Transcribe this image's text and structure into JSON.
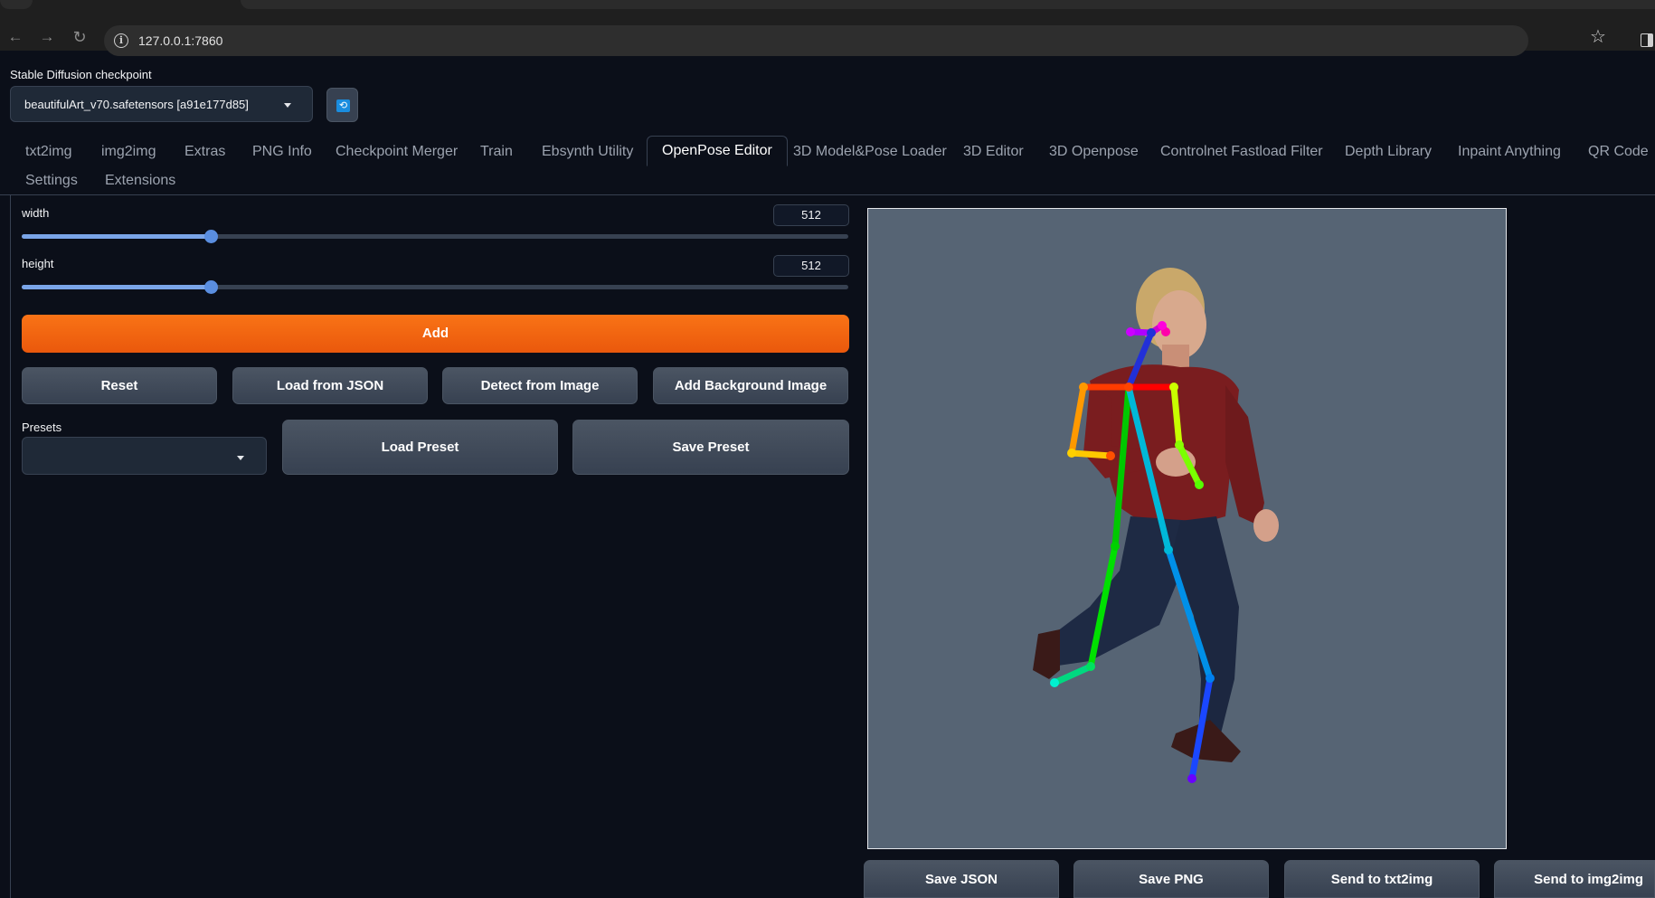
{
  "browser": {
    "url": "127.0.0.1:7860"
  },
  "checkpoint": {
    "label": "Stable Diffusion checkpoint",
    "value": "beautifulArt_v70.safetensors [a91e177d85]",
    "refresh_icon": "refresh-icon",
    "refresh_color": "#1a8ddf"
  },
  "tabs": {
    "row1": [
      "txt2img",
      "img2img",
      "Extras",
      "PNG Info",
      "Checkpoint Merger",
      "Train",
      "Ebsynth Utility",
      "OpenPose Editor",
      "3D Model&Pose Loader",
      "3D Editor",
      "3D Openpose",
      "Controlnet Fastload Filter",
      "Depth Library",
      "Inpaint Anything",
      "QR Code"
    ],
    "row2": [
      "Settings",
      "Extensions"
    ],
    "active": "OpenPose Editor"
  },
  "width": {
    "label": "width",
    "value": "512",
    "fraction": 0.2287
  },
  "height": {
    "label": "height",
    "value": "512",
    "fraction": 0.2287
  },
  "buttons": {
    "add": "Add",
    "reset": "Reset",
    "load_json": "Load from JSON",
    "detect": "Detect from Image",
    "add_bg": "Add Background Image",
    "load_preset": "Load Preset",
    "save_preset": "Save Preset",
    "save_json": "Save JSON",
    "save_png": "Save PNG",
    "send_txt2img": "Send to txt2img",
    "send_img2img": "Send to img2img"
  },
  "presets": {
    "label": "Presets",
    "value": ""
  },
  "colors": {
    "accent": "#f97316",
    "canvas_bg": "#566474",
    "page_bg": "#0b0f19"
  }
}
